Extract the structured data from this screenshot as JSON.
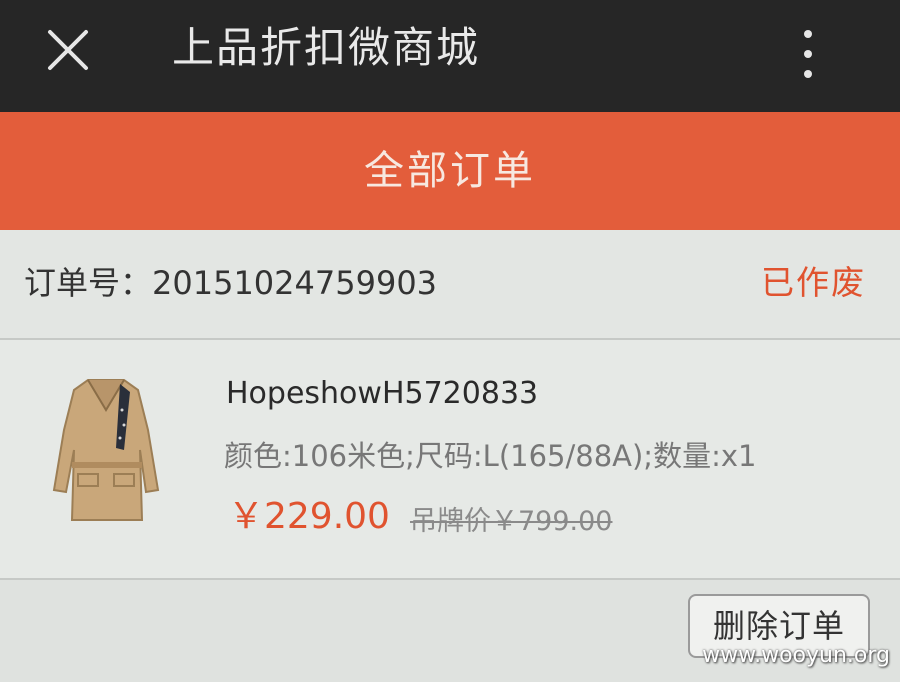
{
  "topbar": {
    "title": "上品折扣微商城",
    "close_icon": "close-icon",
    "more_icon": "more-vertical-icon"
  },
  "header": {
    "title": "全部订单",
    "color": "#e35d3b"
  },
  "order": {
    "id_label": "订单号：20151024759903",
    "status": "已作废",
    "item": {
      "name": "HopeshowH5720833",
      "specs": "颜色:106米色;尺码:L(165/88A);数量:x1",
      "price": "￥229.00",
      "list_price": "吊牌价￥799.00"
    },
    "delete_label": "删除订单"
  },
  "watermark": "www.wooyun.org",
  "colors": {
    "accent": "#e0532f",
    "topbar": "#262626"
  }
}
